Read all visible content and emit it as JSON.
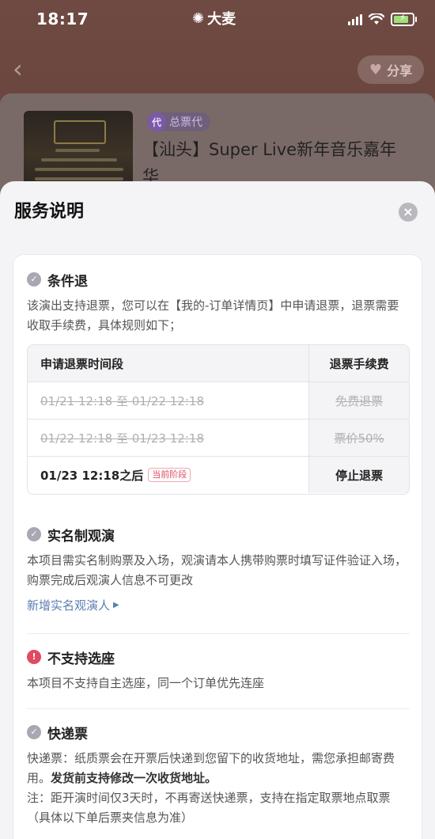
{
  "status_bar": {
    "time": "18:17",
    "brand": "大麦"
  },
  "header": {
    "share_label": "分享"
  },
  "event": {
    "agent_badge": "总票代",
    "title": "【汕头】Super Live新年音乐嘉年华"
  },
  "sheet": {
    "title": "服务说明",
    "sections": [
      {
        "title": "条件退",
        "text": "该演出支持退票，您可以在【我的-订单详情页】中申请退票，退票需要收取手续费，具体规则如下；",
        "table": {
          "headers": [
            "申请退票时间段",
            "退票手续费"
          ],
          "rows": [
            {
              "period": "01/21 12:18 至 01/22 12:18",
              "fee": "免费退票",
              "state": "past"
            },
            {
              "period": "01/22 12:18 至 01/23 12:18",
              "fee": "票价50%",
              "state": "past"
            },
            {
              "period": "01/23 12:18之后",
              "fee": "停止退票",
              "state": "current",
              "tag": "当前阶段"
            }
          ]
        }
      },
      {
        "title": "实名制观演",
        "text": "本项目需实名制购票及入场，观演请本人携带购票时填写证件验证入场，购票完成后观演人信息不可更改",
        "link": "新增实名观演人"
      },
      {
        "title": "不支持选座",
        "text": "本项目不支持自主选座，同一个订单优先连座"
      },
      {
        "title": "快递票",
        "text_a": "快递票：纸质票会在开票后快递到您留下的收货地址，需您承担邮寄费用。",
        "text_b": "发货前支持修改一次收货地址。",
        "text_c": "注：距开演时间仅3天时，不再寄送快递票，支持在指定取票地点取票（具体以下单后票夹信息为准）"
      }
    ]
  },
  "colors": {
    "accent_pink": "#e14a63",
    "link_blue": "#5a7fb0",
    "check_gray": "#a8a8b3"
  }
}
